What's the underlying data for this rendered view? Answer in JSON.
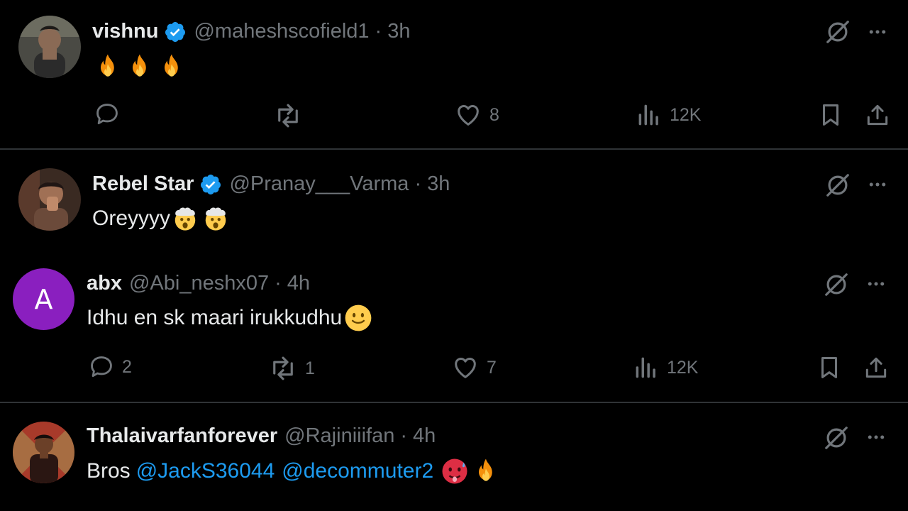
{
  "tweets": [
    {
      "name": "vishnu",
      "handle": "@maheshscofield1",
      "dot": "·",
      "time": "3h",
      "text": "",
      "emojis": [
        "fire",
        "fire",
        "fire"
      ],
      "stats": {
        "replies": "",
        "reposts": "",
        "likes": "8",
        "views": "12K"
      }
    },
    {
      "name": "Rebel Star",
      "handle": "@Pranay___Varma",
      "dot": "·",
      "time": "3h",
      "text": "Oreyyyy",
      "emojis": [
        "exploding-head",
        "exploding-head"
      ]
    },
    {
      "name": "abx",
      "handle": "@Abi_neshx07",
      "dot": "·",
      "time": "4h",
      "avatar_letter": "A",
      "text": "Idhu en sk maari irukkudhu",
      "emojis": [
        "slightly-smiling-face"
      ],
      "stats": {
        "replies": "2",
        "reposts": "1",
        "likes": "7",
        "views": "12K"
      }
    },
    {
      "name": "Thalaivarfanforever",
      "handle": "@Rajiniiifan",
      "dot": "·",
      "time": "4h",
      "text": "Bros",
      "mentions": [
        "@JackS36044",
        "@decommuter2"
      ],
      "emojis": [
        "hot-face",
        "fire"
      ]
    }
  ],
  "colors": {
    "background": "#000000",
    "text": "#e7e9ea",
    "muted": "#71767b",
    "link": "#1d9bf0",
    "verified": "#1d9bf0",
    "divider": "#2f3336",
    "avatar_letter_bg": "#8a1fbf"
  }
}
